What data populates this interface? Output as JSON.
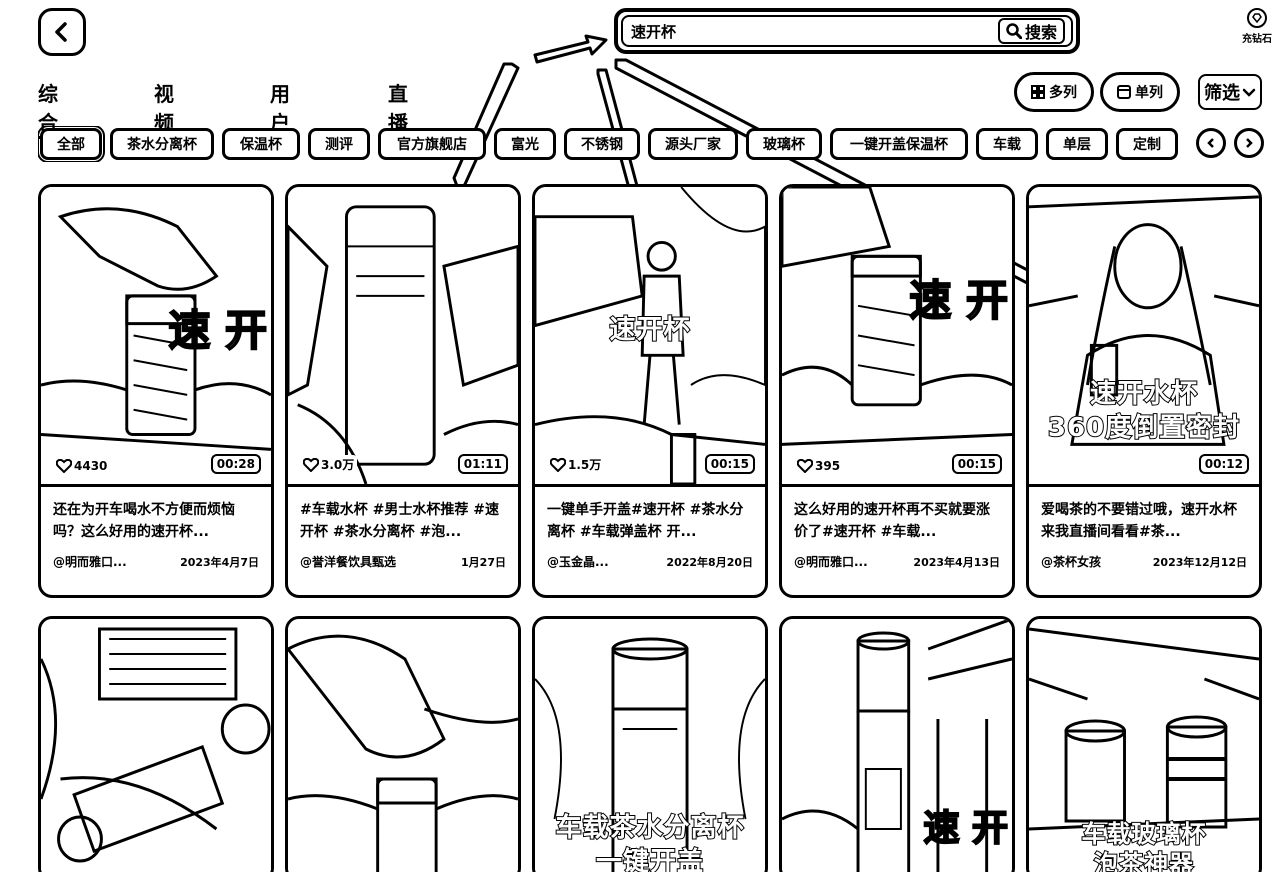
{
  "header": {
    "search_value": "速开杯",
    "search_button": "搜索",
    "diamond_label": "充钻石"
  },
  "tabs": [
    {
      "label": "综合"
    },
    {
      "label": "视频"
    },
    {
      "label": "用户"
    },
    {
      "label": "直播"
    }
  ],
  "view": {
    "multi_label": "多列",
    "single_label": "单列",
    "filter_label": "筛选"
  },
  "chips": [
    "全部",
    "茶水分离杯",
    "保温杯",
    "测评",
    "官方旗舰店",
    "富光",
    "不锈钢",
    "源头厂家",
    "玻璃杯",
    "一键开盖保温杯",
    "车载",
    "单层",
    "定制"
  ],
  "videos": [
    {
      "likes": "4430",
      "duration": "00:28",
      "title": "还在为开车喝水不方便而烦恼吗？这么好用的速开杯...",
      "author": "@明而雅口...",
      "date": "2023年4月7日",
      "overlay": "速 开"
    },
    {
      "likes": "3.0万",
      "duration": "01:11",
      "title": "#车载水杯 #男士水杯推荐 #速开杯 #茶水分离杯 #泡...",
      "author": "@誉洋餐饮具甄选",
      "date": "1月27日",
      "overlay": ""
    },
    {
      "likes": "1.5万",
      "duration": "00:15",
      "title": "一键单手开盖#速开杯 #茶水分离杯 #车载弹盖杯 开...",
      "author": "@玉金晶...",
      "date": "2022年8月20日",
      "overlay": "速开杯"
    },
    {
      "likes": "395",
      "duration": "00:15",
      "title": "这么好用的速开杯再不买就要涨价了#速开杯 #车载...",
      "author": "@明而雅口...",
      "date": "2023年4月13日",
      "overlay": "速 开"
    },
    {
      "likes": "",
      "duration": "00:12",
      "title": "爱喝茶的不要错过哦，速开水杯来我直播间看看#茶...",
      "author": "@茶杯女孩",
      "date": "2023年12月12日",
      "overlay": "速开水杯\n360度倒置密封"
    },
    {
      "overlay": ""
    },
    {
      "overlay": ""
    },
    {
      "overlay": "车载茶水分离杯\n一键开盖"
    },
    {
      "overlay": "速 开"
    },
    {
      "overlay": "车载玻璃杯\n泡茶神器"
    }
  ]
}
